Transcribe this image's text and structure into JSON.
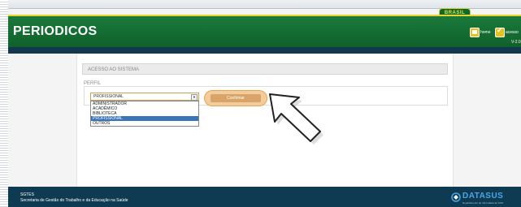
{
  "header": {
    "banner": "BRASIL",
    "title": "PERIODICOS",
    "home_label": "home",
    "access_label": "acesso",
    "version": "V-2.0"
  },
  "form": {
    "section_title": "ACESSO AO SISTEMA",
    "profile_label": "PERFIL",
    "selected": "PROFISSIONAL",
    "options": [
      "ADMINISTRADOR",
      "ACADÊMICO",
      "BIBLIOTECA",
      "PROFISSIONAL",
      "OUTROS"
    ],
    "confirm_label": "Confirmar"
  },
  "footer": {
    "org_short": "SGTES",
    "org_full": "Secretaria de Gestão do Trabalho e da Educação na Saúde",
    "brand": "DATASUS",
    "brand_sub": "Departamento de Informática do SUS"
  },
  "colors": {
    "header_green": "#1a7a3a",
    "accent_yellow": "#e8d431",
    "footer_blue": "#0f3b52",
    "selection_blue": "#3a74b8",
    "button_orange": "#f0a04a"
  }
}
